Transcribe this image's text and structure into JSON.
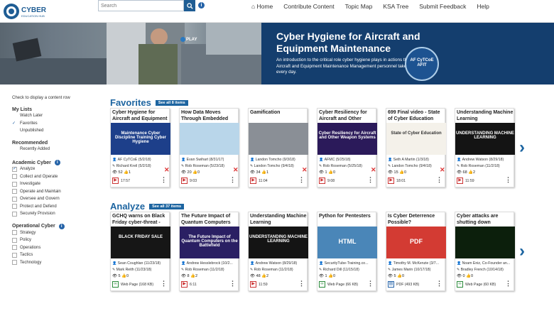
{
  "header": {
    "logo_text": "CYBER EDUCATION HUB",
    "search_placeholder": "Search",
    "nav": [
      "Home",
      "Contribute Content",
      "Topic Map",
      "KSA Tree",
      "Submit Feedback",
      "Help"
    ]
  },
  "banner": {
    "play_label": "PLAY",
    "title": "Cyber Hygiene for Aircraft and Equipment Maintenance",
    "description": "An introduction to the critical role cyber hygiene plays in actions that Aircraft and Equipment Maintenance Management personnel take every day.",
    "seal_text": "AF CyTCoE AFIT"
  },
  "sidebar": {
    "hint": "Check to display a content row",
    "groups": [
      {
        "title": "My Lists",
        "info": false,
        "items": [
          {
            "label": "Watch Later",
            "checked": false,
            "box": false
          },
          {
            "label": "Favorites",
            "checked": true,
            "box": false
          },
          {
            "label": "Unpublished",
            "checked": false,
            "box": false
          }
        ]
      },
      {
        "title": "Recommended",
        "info": false,
        "items": [
          {
            "label": "Recently Added",
            "checked": false,
            "box": false
          }
        ]
      },
      {
        "title": "Academic Cyber",
        "info": true,
        "items": [
          {
            "label": "Analyze",
            "checked": true,
            "box": true
          },
          {
            "label": "Collect and Operate",
            "checked": false,
            "box": true
          },
          {
            "label": "Investigate",
            "checked": false,
            "box": true
          },
          {
            "label": "Operate and Maintain",
            "checked": false,
            "box": true
          },
          {
            "label": "Oversee and Govern",
            "checked": false,
            "box": true
          },
          {
            "label": "Protect and Defend",
            "checked": false,
            "box": true
          },
          {
            "label": "Securely Provision",
            "checked": false,
            "box": true
          }
        ]
      },
      {
        "title": "Operational Cyber",
        "info": true,
        "items": [
          {
            "label": "Strategy",
            "checked": false,
            "box": true
          },
          {
            "label": "Policy",
            "checked": false,
            "box": true
          },
          {
            "label": "Operations",
            "checked": false,
            "box": true
          },
          {
            "label": "Tactics",
            "checked": false,
            "box": true
          },
          {
            "label": "Technology",
            "checked": false,
            "box": true
          }
        ]
      }
    ]
  },
  "favorites": {
    "title": "Favorites",
    "see_all": "See all 8 items",
    "cards": [
      {
        "title": "Cyber Hygiene for Aircraft and Equipment",
        "thumb_text": "Maintenance Cyber Discipline Training Cyber Hygiene",
        "thumb_color": "#1d3f8a",
        "author": "AF CyTCoE (5/2/18)",
        "editor": "Richard Kreil (5/2/18)",
        "views": "52",
        "likes": "1",
        "footer": "17:57",
        "removable": true
      },
      {
        "title": "How Data Moves Through Embedded",
        "thumb_text": "",
        "thumb_color": "#b9d6ea",
        "author": "Evan Swihart (8/31/17)",
        "editor": "Rob Roseman (5/23/18)",
        "views": "20",
        "likes": "0",
        "footer": "9:03",
        "removable": true
      },
      {
        "title": "Gamification",
        "thumb_text": "",
        "thumb_color": "#8a8f96",
        "author": "Landon Tomcho (9/3/18)",
        "editor": "Landon Tomcho (9/4/18)",
        "views": "34",
        "likes": "1",
        "footer": "11:04",
        "removable": true
      },
      {
        "title": "Cyber Resiliency for Aircraft and Other",
        "thumb_text": "Cyber Resiliency for Aircraft and Other Weapon Systems",
        "thumb_color": "#2b1a5a",
        "author": "AFMC (5/25/18)",
        "editor": "Rob Roseman (5/25/18)",
        "views": "1",
        "likes": "0",
        "footer": "9:08",
        "removable": true
      },
      {
        "title": "699 Final video - State of Cyber Education",
        "thumb_text": "State of Cyber Education",
        "thumb_color": "#f4f1ea",
        "author": "Seth A Martin (1/3/18)",
        "editor": "Landon Tomcho (9/4/18)",
        "views": "15",
        "likes": "0",
        "footer": "18:01",
        "removable": true
      },
      {
        "title": "Understanding Machine Learning",
        "thumb_text": "UNDERSTANDING MACHINE LEARNING",
        "thumb_color": "#141414",
        "author": "Andrew Watson (8/29/18)",
        "editor": "Rob Roseman (11/2/18)",
        "views": "68",
        "likes": "2",
        "footer": "11:59",
        "removable": false
      }
    ]
  },
  "analyze": {
    "title": "Analyze",
    "see_all": "See all 37 items",
    "cards": [
      {
        "title": "GCHQ warns on Black Friday cyber-threat -",
        "thumb_text": "BLACK FRIDAY SALE",
        "thumb_color": "#161616",
        "author": "Sean Coughlan (11/23/18)",
        "editor": "Mark Reith (11/23/18)",
        "views": "5",
        "likes": "0",
        "footer": "Web Page (168 KB)",
        "kind": "web"
      },
      {
        "title": "The Future Impact of Quantum Computers",
        "thumb_text": "The Future Impact of Quantum Computers on the Battlefield",
        "thumb_color": "#2a1f63",
        "author": "Andrew Hesslebrock (10/2...",
        "editor": "Rob Roseman (11/2/18)",
        "views": "8",
        "likes": "2",
        "footer": "6:11",
        "kind": "video"
      },
      {
        "title": "Understanding Machine Learning",
        "thumb_text": "UNDERSTANDING MACHINE LEARNING",
        "thumb_color": "#141414",
        "author": "Andrew Watson (8/29/18)",
        "editor": "Rob Roseman (11/2/18)",
        "views": "48",
        "likes": "2",
        "footer": "11:59",
        "kind": "video"
      },
      {
        "title": "Python for Pentesters",
        "thumb_text": "HTML",
        "thumb_color": "#4a86b8",
        "author": "SecurityTube-Training.co...",
        "editor": "Richard Dill (11/15/18)",
        "views": "1",
        "likes": "0",
        "footer": "Web Page (66 KB)",
        "kind": "web"
      },
      {
        "title": "Is Cyber Deterrence Possible?",
        "thumb_text": "PDF",
        "thumb_color": "#d33b33",
        "author": "Timothy M. McKenzie (3/7...",
        "editor": "James Marin (10/17/18)",
        "views": "5",
        "likes": "0",
        "footer": "PDF (493 KB)",
        "kind": "pdf"
      },
      {
        "title": "Cyber attacks are shutting down",
        "thumb_text": "",
        "thumb_color": "#0c1f0c",
        "author": "Noam Eniz, Co-Founder an...",
        "editor": "Bradley French (10/14/18)",
        "views": "0",
        "likes": "0",
        "footer": "Web Page (60 KB)",
        "kind": "web"
      }
    ]
  }
}
